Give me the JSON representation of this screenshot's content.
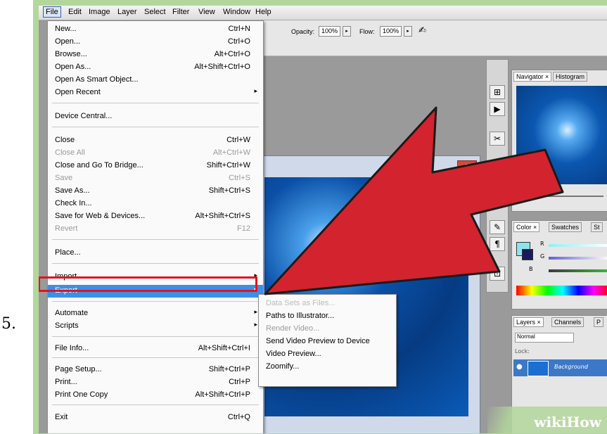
{
  "step": {
    "number": "5."
  },
  "menubar": [
    "File",
    "Edit",
    "Image",
    "Layer",
    "Select",
    "Filter",
    "View",
    "Window",
    "Help"
  ],
  "options": {
    "opacity_label": "Opacity:",
    "opacity_value": "100%",
    "flow_label": "Flow:",
    "flow_value": "100%",
    "arrow": "▸"
  },
  "file_menu": [
    {
      "label": "New...",
      "shortcut": "Ctrl+N"
    },
    {
      "label": "Open...",
      "shortcut": "Ctrl+O"
    },
    {
      "label": "Browse...",
      "shortcut": "Alt+Ctrl+O"
    },
    {
      "label": "Open As...",
      "shortcut": "Alt+Shift+Ctrl+O"
    },
    {
      "label": "Open As Smart Object...",
      "shortcut": ""
    },
    {
      "label": "Open Recent",
      "shortcut": ""
    },
    {
      "label": "Device Central...",
      "shortcut": ""
    },
    {
      "label": "Close",
      "shortcut": "Ctrl+W"
    },
    {
      "label": "Close All",
      "shortcut": "Alt+Ctrl+W"
    },
    {
      "label": "Close and Go To Bridge...",
      "shortcut": "Shift+Ctrl+W"
    },
    {
      "label": "Save",
      "shortcut": "Ctrl+S"
    },
    {
      "label": "Save As...",
      "shortcut": "Shift+Ctrl+S"
    },
    {
      "label": "Check In...",
      "shortcut": ""
    },
    {
      "label": "Save for Web & Devices...",
      "shortcut": "Alt+Shift+Ctrl+S"
    },
    {
      "label": "Revert",
      "shortcut": "F12"
    },
    {
      "label": "Place...",
      "shortcut": ""
    },
    {
      "label": "Import",
      "shortcut": ""
    },
    {
      "label": "Export",
      "shortcut": ""
    },
    {
      "label": "Automate",
      "shortcut": ""
    },
    {
      "label": "Scripts",
      "shortcut": ""
    },
    {
      "label": "File Info...",
      "shortcut": "Alt+Shift+Ctrl+I"
    },
    {
      "label": "Page Setup...",
      "shortcut": "Shift+Ctrl+P"
    },
    {
      "label": "Print...",
      "shortcut": "Ctrl+P"
    },
    {
      "label": "Print One Copy",
      "shortcut": "Alt+Shift+Ctrl+P"
    },
    {
      "label": "Exit",
      "shortcut": "Ctrl+Q"
    }
  ],
  "submenu_glyph": "▸",
  "export_submenu": [
    "Data Sets as Files...",
    "Paths to Illustrator...",
    "Render Video...",
    "Send Video Preview to Device",
    "Video Preview...",
    "Zoomify..."
  ],
  "panels": {
    "navigator_tabs": [
      "Navigator ×",
      "Histogram"
    ],
    "color_tabs": [
      "Color ×",
      "Swatches",
      "St"
    ],
    "color_channels": [
      "R",
      "G",
      "B"
    ],
    "layers_tabs": [
      "Layers ×",
      "Channels",
      "P"
    ],
    "blend_mode": "Normal",
    "lock_label": "Lock:",
    "layer_name": "Background"
  },
  "doc_close": "x",
  "watermark": "wikiHow",
  "colors": {
    "frame": "#b3d79b",
    "highlight": "#3d8ee6",
    "outline": "#e0141d",
    "arrow": "#d3232e"
  }
}
